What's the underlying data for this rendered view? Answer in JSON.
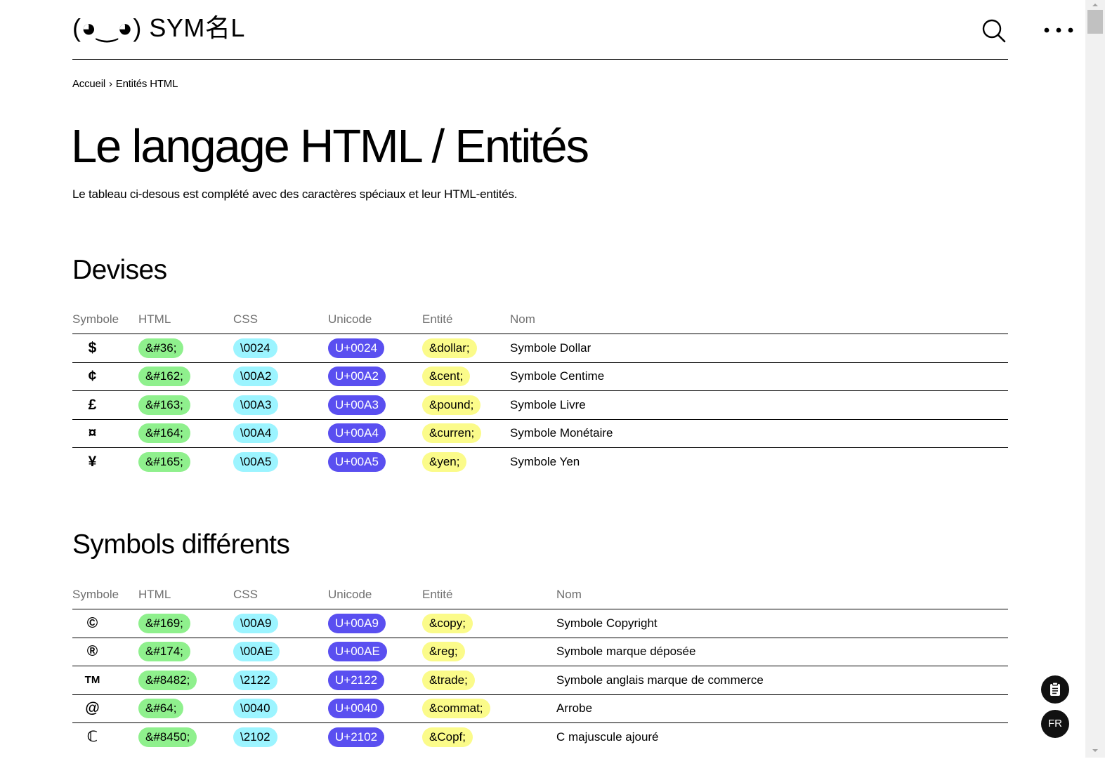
{
  "header": {
    "logo_text": "(◕‿◕) SYM名L",
    "search_icon": "search-icon",
    "more_icon": "more-dots-icon"
  },
  "breadcrumb": {
    "home": "Accueil",
    "separator": "›",
    "current": "Entités HTML"
  },
  "page": {
    "title": "Le langage HTML / Entités",
    "intro": "Le tableau ci-desous est complété avec des caractères spéciaux et leur HTML-entités."
  },
  "columns": {
    "symbol": "Symbole",
    "html": "HTML",
    "css": "CSS",
    "unicode": "Unicode",
    "entity": "Entité",
    "name": "Nom"
  },
  "sections": [
    {
      "title": "Devises",
      "rows": [
        {
          "symbol": "$",
          "html": "&#36;",
          "css": "\\0024",
          "unicode": "U+0024",
          "entity": "&dollar;",
          "name": "Symbole Dollar"
        },
        {
          "symbol": "¢",
          "html": "&#162;",
          "css": "\\00A2",
          "unicode": "U+00A2",
          "entity": "&cent;",
          "name": "Symbole Centime"
        },
        {
          "symbol": "£",
          "html": "&#163;",
          "css": "\\00A3",
          "unicode": "U+00A3",
          "entity": "&pound;",
          "name": "Symbole Livre"
        },
        {
          "symbol": "¤",
          "html": "&#164;",
          "css": "\\00A4",
          "unicode": "U+00A4",
          "entity": "&curren;",
          "name": "Symbole Monétaire"
        },
        {
          "symbol": "¥",
          "html": "&#165;",
          "css": "\\00A5",
          "unicode": "U+00A5",
          "entity": "&yen;",
          "name": "Symbole Yen"
        }
      ]
    },
    {
      "title": "Symbols différents",
      "rows": [
        {
          "symbol": "©",
          "html": "&#169;",
          "css": "\\00A9",
          "unicode": "U+00A9",
          "entity": "&copy;",
          "name": "Symbole Copyright"
        },
        {
          "symbol": "®",
          "html": "&#174;",
          "css": "\\00AE",
          "unicode": "U+00AE",
          "entity": "&reg;",
          "name": "Symbole marque déposée"
        },
        {
          "symbol": "TM",
          "html": "&#8482;",
          "css": "\\2122",
          "unicode": "U+2122",
          "entity": "&trade;",
          "name": "Symbole anglais marque de commerce"
        },
        {
          "symbol": "@",
          "html": "&#64;",
          "css": "\\0040",
          "unicode": "U+0040",
          "entity": "&commat;",
          "name": "Arrobe"
        },
        {
          "symbol": "ℂ",
          "html": "&#8450;",
          "css": "\\2102",
          "unicode": "U+2102",
          "entity": "&Copf;",
          "name": "C majuscule ajouré"
        }
      ]
    }
  ],
  "floating": {
    "clipboard_icon": "clipboard-icon",
    "language": "FR"
  },
  "colors": {
    "html_pill": "#8ff08d",
    "css_pill": "#9cf4ff",
    "unicode_pill": "#5a4ff0",
    "entity_pill": "#fbfb8a",
    "fab": "#111111"
  }
}
